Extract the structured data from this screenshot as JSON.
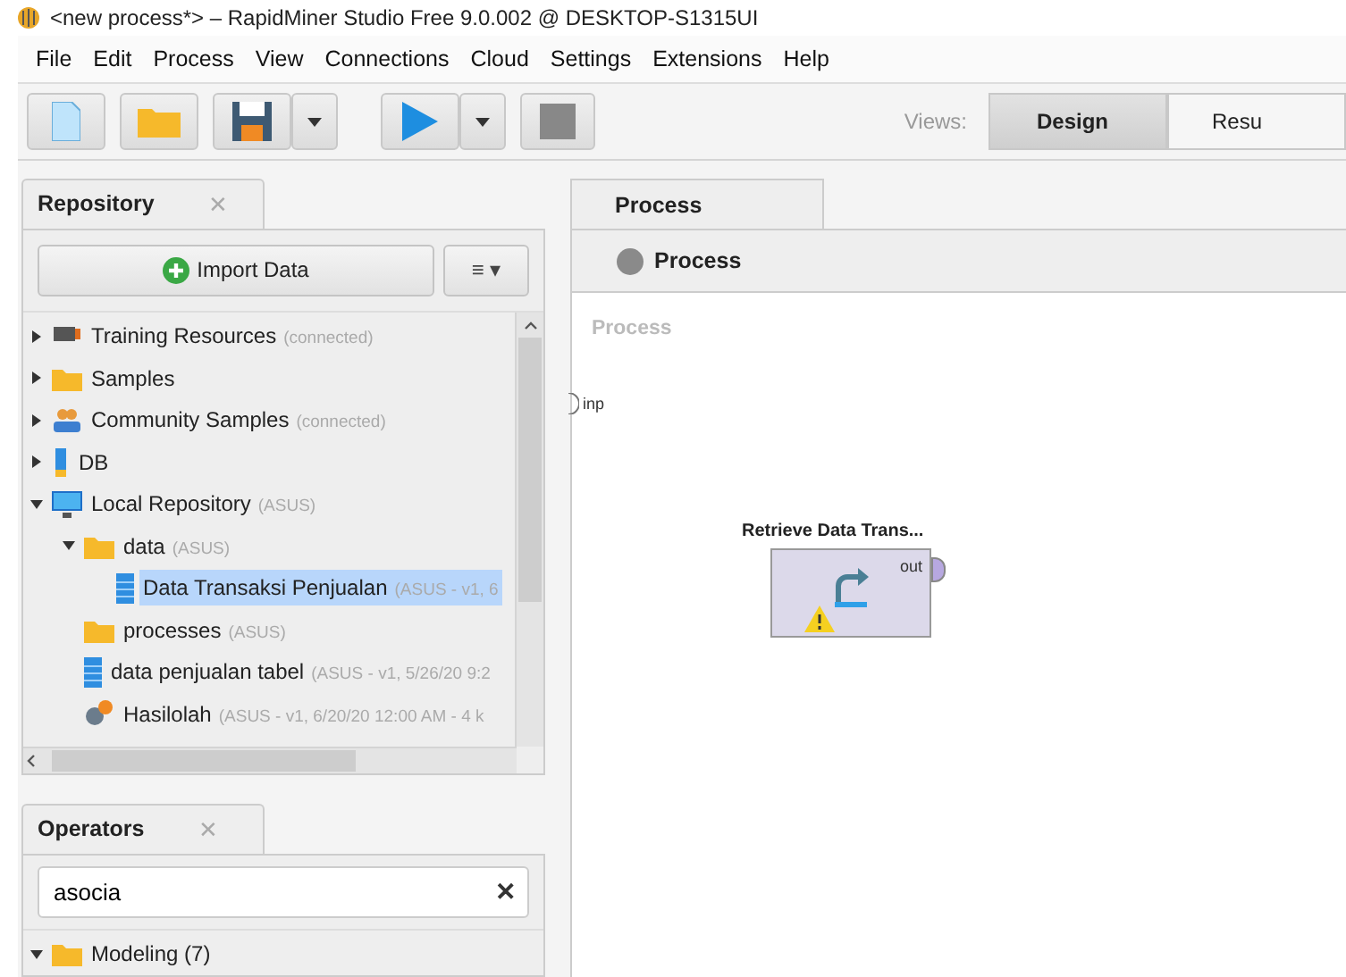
{
  "window": {
    "title": "<new process*> – RapidMiner Studio Free 9.0.002 @ DESKTOP-S1315UI"
  },
  "menu": [
    "File",
    "Edit",
    "Process",
    "View",
    "Connections",
    "Cloud",
    "Settings",
    "Extensions",
    "Help"
  ],
  "toolbar": {
    "views_label": "Views:",
    "views": [
      {
        "label": "Design",
        "selected": true
      },
      {
        "label": "Resu",
        "selected": false
      }
    ]
  },
  "repository": {
    "tab": {
      "label": "Repository",
      "close": "✕"
    },
    "import_button": "Import Data",
    "menu_button": "≡ ▾",
    "tree": [
      {
        "kind": "training",
        "name": "Training Resources",
        "detail": "(connected)",
        "expanded": false
      },
      {
        "kind": "folder",
        "name": "Samples",
        "expanded": false
      },
      {
        "kind": "community",
        "name": "Community Samples",
        "detail": "(connected)",
        "expanded": false
      },
      {
        "kind": "db",
        "name": "DB",
        "expanded": false
      },
      {
        "kind": "repository",
        "name": "Local Repository",
        "detail": "(ASUS)",
        "expanded": true,
        "children": [
          {
            "kind": "folder",
            "name": "data",
            "detail": "(ASUS)",
            "expanded": true,
            "children": [
              {
                "kind": "data",
                "name": "Data Transaksi Penjualan",
                "detail": "(ASUS - v1, 6",
                "selected": true
              }
            ]
          },
          {
            "kind": "folder",
            "name": "processes",
            "detail": "(ASUS)",
            "selected": false
          },
          {
            "kind": "data",
            "name": "data penjualan tabel",
            "detail": "(ASUS - v1, 5/26/20 9:2",
            "selected": false
          },
          {
            "kind": "process",
            "name": "Hasilolah",
            "detail": "(ASUS - v1, 6/20/20 12:00 AM - 4 k",
            "selected": false
          }
        ]
      }
    ]
  },
  "operators": {
    "tab": {
      "label": "Operators",
      "close": "✕"
    },
    "search": {
      "value": "asocia",
      "clear": "✕"
    },
    "tree": [
      {
        "kind": "folder",
        "name": "Modeling (7)",
        "expanded": true
      }
    ]
  },
  "process": {
    "tab": "Process",
    "breadcrumb": "Process",
    "canvas_label": "Process",
    "input_port": "inp",
    "operator": {
      "name": "Retrieve Data Trans...",
      "port": "out",
      "warning": true
    }
  }
}
